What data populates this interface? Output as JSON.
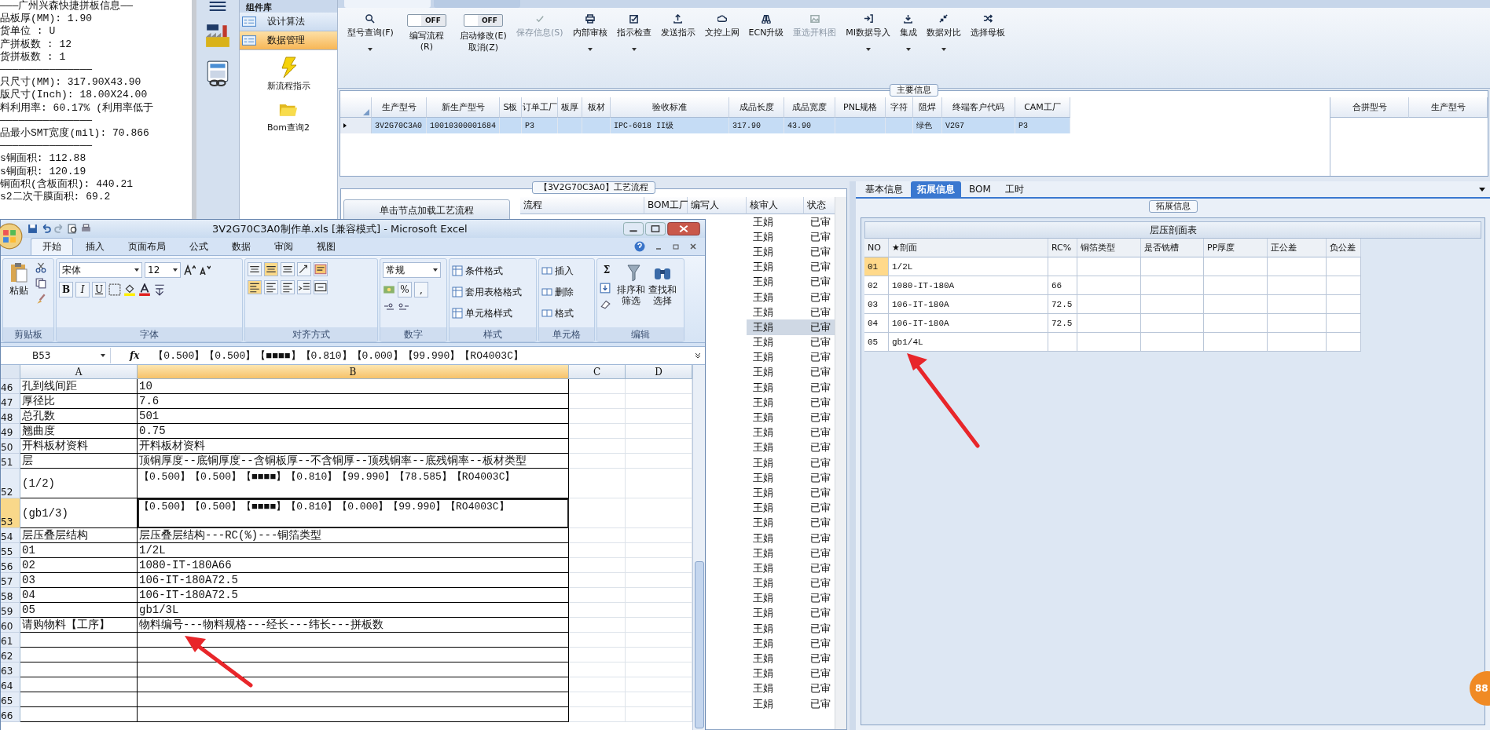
{
  "info_panel": {
    "lines": [
      "———广州兴森快捷拼板信息——",
      "品板厚(MM): 1.90",
      "货单位 : U",
      "产拼板数 : 12",
      "货拼板数 : 1",
      "———————————————",
      "只尺寸(MM): 317.90X43.90",
      "版尺寸(Inch): 18.00X24.00",
      "料利用率: 60.17% (利用率低于",
      "———————————————",
      "品最小SMT宽度(mil): 70.866",
      "———————————————",
      "s铜面积: 112.88",
      "s铜面积: 120.19",
      "铜面积(含板面积): 440.21",
      "s2二次干膜面积: 69.2"
    ]
  },
  "component_panel": {
    "title": "组件库",
    "items": [
      {
        "label": "设计算法",
        "selected": false
      },
      {
        "label": "数据管理",
        "selected": true
      }
    ],
    "tiles": [
      {
        "label": "新流程指示"
      },
      {
        "label": "Bom查询2"
      }
    ]
  },
  "toolbar": [
    {
      "kind": "button",
      "label": "型号查询(F)",
      "dropdown": true,
      "disabled": false
    },
    {
      "kind": "toggle",
      "label": "编写流程(R)",
      "switch_text": "OFF",
      "on": false
    },
    {
      "kind": "toggle",
      "label": "启动修改(E) 取消(Z)",
      "switch_text": "OFF",
      "on": false
    },
    {
      "kind": "button",
      "label": "保存信息(S)",
      "dropdown": false,
      "disabled": true
    },
    {
      "kind": "button",
      "label": "内部审核",
      "dropdown": true,
      "disabled": false
    },
    {
      "kind": "button",
      "label": "指示检查",
      "dropdown": true,
      "disabled": false
    },
    {
      "kind": "button",
      "label": "发送指示",
      "dropdown": false,
      "disabled": false
    },
    {
      "kind": "button",
      "label": "文控上网",
      "dropdown": false,
      "disabled": false
    },
    {
      "kind": "button",
      "label": "ECN升级",
      "dropdown": false,
      "disabled": false
    },
    {
      "kind": "button",
      "label": "重选开料图",
      "dropdown": false,
      "disabled": true
    },
    {
      "kind": "button",
      "label": "MI数据导入",
      "dropdown": true,
      "disabled": false
    },
    {
      "kind": "button",
      "label": "集成",
      "dropdown": true,
      "disabled": false
    },
    {
      "kind": "button",
      "label": "数据对比",
      "dropdown": true,
      "disabled": false
    },
    {
      "kind": "button",
      "label": "选择母板",
      "dropdown": false,
      "disabled": false
    }
  ],
  "main_info": {
    "legend": "主要信息",
    "columns": [
      "生产型号",
      "新生产型号",
      "S板",
      "订单工厂",
      "板厚",
      "板材",
      "验收标准",
      "成品长度",
      "成品宽度",
      "PNL规格",
      "字符",
      "阻焊",
      "终端客户代码",
      "CAM工厂"
    ],
    "rows": [
      {
        "selected": true,
        "cells": [
          "3V2G70C3A0",
          "10010300001684",
          null,
          "P3",
          null,
          null,
          "IPC-6018 II级",
          "317.90",
          "43.90",
          null,
          null,
          "绿色",
          "V2G7",
          "P3"
        ]
      }
    ],
    "side_columns": [
      "合拼型号",
      "生产型号"
    ]
  },
  "process": {
    "legend": "【3V2G70C3A0】工艺流程",
    "load_button": "单击节点加载工艺流程",
    "columns": [
      "流程",
      "BOM工厂",
      "编写人",
      "核审人",
      "状态"
    ],
    "rows": [
      {
        "reviewer": "王娟",
        "status": "已审",
        "selected": false
      },
      {
        "reviewer": "王娟",
        "status": "已审",
        "selected": false
      },
      {
        "reviewer": "王娟",
        "status": "已审",
        "selected": false
      },
      {
        "reviewer": "王娟",
        "status": "已审",
        "selected": false
      },
      {
        "reviewer": "王娟",
        "status": "已审",
        "selected": false
      },
      {
        "reviewer": "王娟",
        "status": "已审",
        "selected": false
      },
      {
        "reviewer": "王娟",
        "status": "已审",
        "selected": false
      },
      {
        "reviewer": "王娟",
        "status": "已审",
        "selected": true
      },
      {
        "reviewer": "王娟",
        "status": "已审",
        "selected": false
      },
      {
        "reviewer": "王娟",
        "status": "已审",
        "selected": false
      },
      {
        "reviewer": "王娟",
        "status": "已审",
        "selected": false
      },
      {
        "reviewer": "王娟",
        "status": "已审",
        "selected": false
      },
      {
        "reviewer": "王娟",
        "status": "已审",
        "selected": false
      },
      {
        "reviewer": "王娟",
        "status": "已审",
        "selected": false
      },
      {
        "reviewer": "王娟",
        "status": "已审",
        "selected": false
      },
      {
        "reviewer": "王娟",
        "status": "已审",
        "selected": false
      },
      {
        "reviewer": "王娟",
        "status": "已审",
        "selected": false
      },
      {
        "reviewer": "王娟",
        "status": "已审",
        "selected": false
      },
      {
        "reviewer": "王娟",
        "status": "已审",
        "selected": false
      },
      {
        "reviewer": "王娟",
        "status": "已审",
        "selected": false
      },
      {
        "reviewer": "王娟",
        "status": "已审",
        "selected": false
      },
      {
        "reviewer": "王娟",
        "status": "已审",
        "selected": false
      },
      {
        "reviewer": "王娟",
        "status": "已审",
        "selected": false
      },
      {
        "reviewer": "王娟",
        "status": "已审",
        "selected": false
      },
      {
        "reviewer": "王娟",
        "status": "已审",
        "selected": false
      },
      {
        "reviewer": "王娟",
        "status": "已审",
        "selected": false
      },
      {
        "reviewer": "王娟",
        "status": "已审",
        "selected": false
      },
      {
        "reviewer": "王娟",
        "status": "已审",
        "selected": false
      },
      {
        "reviewer": "王娟",
        "status": "已审",
        "selected": false
      },
      {
        "reviewer": "王娟",
        "status": "已审",
        "selected": false
      },
      {
        "reviewer": "王娟",
        "status": "已审",
        "selected": false
      },
      {
        "reviewer": "王娟",
        "status": "已审",
        "selected": false
      },
      {
        "reviewer": "王娟",
        "status": "已审",
        "selected": false
      }
    ]
  },
  "detail": {
    "tabs": [
      {
        "label": "基本信息",
        "selected": false
      },
      {
        "label": "拓展信息",
        "selected": true
      },
      {
        "label": "BOM",
        "selected": false
      },
      {
        "label": "工时",
        "selected": false
      }
    ],
    "legend": "拓展信息",
    "table_title": "层压剖面表",
    "columns": [
      "NO",
      "★剖面",
      "RC%",
      "铜箔类型",
      "是否铣槽",
      "PP厚度",
      "正公差",
      "负公差"
    ],
    "rows": [
      {
        "selected": true,
        "cells": [
          "01",
          "1/2L",
          null
        ]
      },
      {
        "selected": false,
        "cells": [
          "02",
          "1080-IT-180A",
          "66"
        ]
      },
      {
        "selected": false,
        "cells": [
          "03",
          "106-IT-180A",
          "72.5"
        ]
      },
      {
        "selected": false,
        "cells": [
          "04",
          "106-IT-180A",
          "72.5"
        ]
      },
      {
        "selected": false,
        "cells": [
          "05",
          "gb1/4L",
          null
        ]
      }
    ]
  },
  "excel": {
    "title": "3V2G70C3A0制作单.xls  [兼容模式] - Microsoft Excel",
    "tabs": [
      {
        "label": "开始",
        "selected": true
      },
      {
        "label": "插入",
        "selected": false
      },
      {
        "label": "页面布局",
        "selected": false
      },
      {
        "label": "公式",
        "selected": false
      },
      {
        "label": "数据",
        "selected": false
      },
      {
        "label": "审阅",
        "selected": false
      },
      {
        "label": "视图",
        "selected": false
      }
    ],
    "paste": "粘贴",
    "font_name": "宋体",
    "font_size": "12",
    "style_buttons": [
      "B",
      "I",
      "U"
    ],
    "number_format": "常规",
    "percent": "%",
    "comma": ",",
    "style_items": [
      "条件格式",
      "套用表格格式",
      "单元格样式"
    ],
    "cell_items": [
      "插入",
      "删除",
      "格式"
    ],
    "sigma": "Σ",
    "edit_items": [
      "排序和筛选",
      "查找和选择"
    ],
    "groups": [
      "剪贴板",
      "字体",
      "对齐方式",
      "数字",
      "样式",
      "单元格",
      "编辑"
    ],
    "name_box": "B53",
    "fx": "fx",
    "formula": "【0.500】【0.500】【■■■■】【0.810】【0.000】【99.990】【RO4003C】",
    "columns": [
      {
        "label": "A",
        "selected": false
      },
      {
        "label": "B",
        "selected": true
      },
      {
        "label": "C",
        "selected": false
      },
      {
        "label": "D",
        "selected": false
      }
    ],
    "rows": [
      {
        "num": "46",
        "a": "孔到线间距",
        "b": "10",
        "tall": false,
        "selected": false
      },
      {
        "num": "47",
        "a": "厚径比",
        "b": "7.6",
        "tall": false,
        "selected": false
      },
      {
        "num": "48",
        "a": "总孔数",
        "b": "501",
        "tall": false,
        "selected": false
      },
      {
        "num": "49",
        "a": "翘曲度",
        "b": "0.75",
        "tall": false,
        "selected": false
      },
      {
        "num": "50",
        "a": "开料板材资料",
        "b": "开料板材资料",
        "tall": false,
        "selected": false
      },
      {
        "num": "51",
        "a": "层",
        "b": "顶铜厚度--底铜厚度--含铜板厚--不含铜厚--顶残铜率--底残铜率--板材类型",
        "tall": false,
        "selected": false
      },
      {
        "num": "52",
        "a": "(1/2)",
        "b": "【0.500】【0.500】【■■■■】【0.810】【99.990】【78.585】【RO4003C】",
        "tall": true,
        "selected": false
      },
      {
        "num": "53",
        "a": "(gb1/3)",
        "b": "【0.500】【0.500】【■■■■】【0.810】【0.000】【99.990】【RO4003C】",
        "tall": true,
        "selected": true
      },
      {
        "num": "54",
        "a": "层压叠层结构",
        "b": "层压叠层结构---RC(%)---铜箔类型",
        "tall": false,
        "selected": false
      },
      {
        "num": "55",
        "a": "01",
        "b": "1/2L",
        "tall": false,
        "selected": false
      },
      {
        "num": "56",
        "a": "02",
        "b": "1080-IT-180A66",
        "tall": false,
        "selected": false
      },
      {
        "num": "57",
        "a": "03",
        "b": "106-IT-180A72.5",
        "tall": false,
        "selected": false
      },
      {
        "num": "58",
        "a": "04",
        "b": "106-IT-180A72.5",
        "tall": false,
        "selected": false
      },
      {
        "num": "59",
        "a": "05",
        "b": "gb1/3L",
        "tall": false,
        "selected": false
      },
      {
        "num": "60",
        "a": "请购物料【工序】",
        "b": "物料编号---物料规格---经长---纬长---拼板数",
        "tall": false,
        "selected": false
      },
      {
        "num": "61",
        "tall": false,
        "selected": false
      },
      {
        "num": "62",
        "tall": false,
        "selected": false
      },
      {
        "num": "63",
        "tall": false,
        "selected": false
      },
      {
        "num": "64",
        "tall": false,
        "selected": false
      },
      {
        "num": "65",
        "tall": false,
        "selected": false
      },
      {
        "num": "66",
        "tall": false,
        "selected": false
      }
    ]
  },
  "badge": "88"
}
